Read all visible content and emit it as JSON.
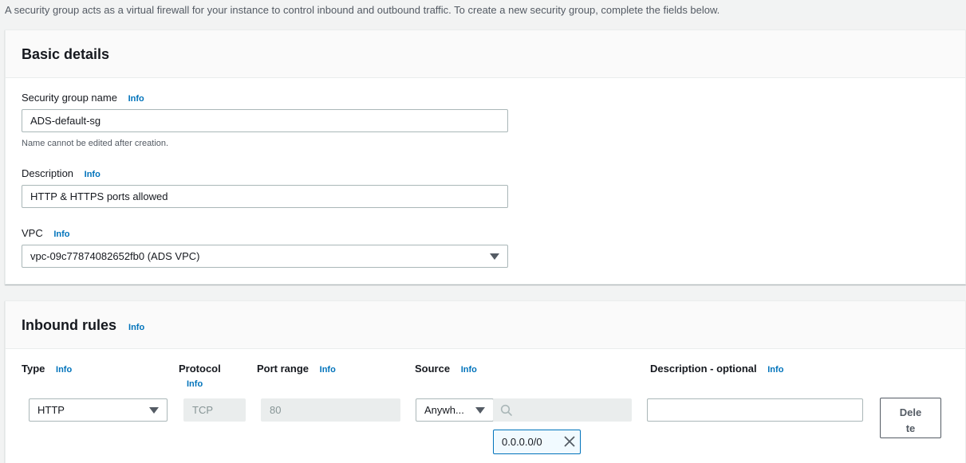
{
  "intro_text": "A security group acts as a virtual firewall for your instance to control inbound and outbound traffic. To create a new security group, complete the fields below.",
  "basic_details": {
    "title": "Basic details",
    "name": {
      "label": "Security group name",
      "info": "Info",
      "value": "ADS-default-sg",
      "hint": "Name cannot be edited after creation."
    },
    "description": {
      "label": "Description",
      "info": "Info",
      "value": "HTTP & HTTPS ports allowed"
    },
    "vpc": {
      "label": "VPC",
      "info": "Info",
      "selected": "vpc-09c77874082652fb0 (ADS VPC)"
    }
  },
  "inbound_rules": {
    "title": "Inbound rules",
    "info": "Info",
    "columns": {
      "type": {
        "label": "Type",
        "info": "Info"
      },
      "protocol": {
        "label": "Protocol",
        "info": "Info"
      },
      "port_range": {
        "label": "Port range",
        "info": "Info"
      },
      "source": {
        "label": "Source",
        "info": "Info"
      },
      "description": {
        "label": "Description - optional",
        "info": "Info"
      }
    },
    "rows": [
      {
        "type": "HTTP",
        "protocol": "TCP",
        "port_range": "80",
        "source_type": "Anywh...",
        "source_search_value": "",
        "source_tokens": [
          "0.0.0.0/0"
        ],
        "description": "",
        "delete_label_line1": "Dele",
        "delete_label_line2": "te"
      }
    ]
  },
  "icons": {
    "info": "info-link",
    "caret": "caret-down-icon",
    "search": "search-icon",
    "close": "close-icon"
  },
  "colors": {
    "link": "#0073bb",
    "text": "#16191f",
    "muted": "#545b64",
    "border": "#aab7b8"
  }
}
